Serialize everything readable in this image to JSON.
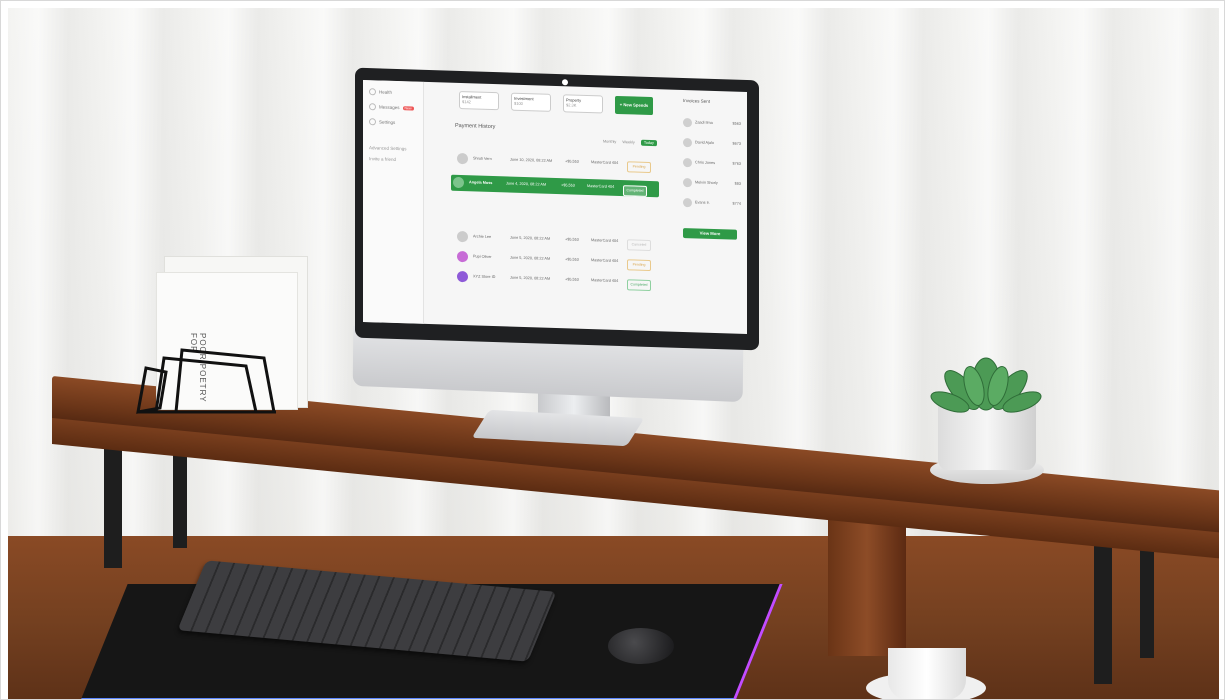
{
  "screen": {
    "sidebar": [
      {
        "label": "Health",
        "badge": ""
      },
      {
        "label": "Messages",
        "badge": "New"
      },
      {
        "label": "Settings",
        "badge": ""
      }
    ],
    "sidebar_footer": [
      "Advanced Settings",
      "Invite a friend"
    ],
    "cards": [
      {
        "label": "Installment",
        "value": "$142"
      },
      {
        "label": "Investment",
        "value": "$100"
      },
      {
        "label": "Property",
        "value": "$2.3K"
      }
    ],
    "new_spends_button": "+ New Spends",
    "payment_history_title": "Payment History",
    "filters": [
      "Monthly",
      "Weekly",
      "Today"
    ],
    "rows": [
      {
        "name": "Shruti Vern",
        "date": "June 10, 2020, 08:22 AM",
        "amount": "+$5,553",
        "method": "MasterCard 404",
        "status": "Pending"
      },
      {
        "name": "Angela Moss",
        "date": "June 4, 2020, 08:22 AM",
        "amount": "+$5,553",
        "method": "MasterCard 404",
        "status": "Completed"
      },
      {
        "name": "Archie Lee",
        "date": "June 5, 2020, 08:22 AM",
        "amount": "+$5,553",
        "method": "MasterCard 404",
        "status": "Canceled"
      },
      {
        "name": "Pupi Oliver",
        "date": "June 5, 2020, 08:22 AM",
        "amount": "+$5,553",
        "method": "MasterCard 404",
        "status": "Pending"
      },
      {
        "name": "XYZ Store ID",
        "date": "June 5, 2020, 08:22 AM",
        "amount": "+$5,553",
        "method": "MasterCard 404",
        "status": "Completed"
      }
    ],
    "invoices_title": "Invoices Sent",
    "invoices": [
      {
        "name": "Zaadi Ilma",
        "amount": "$563"
      },
      {
        "name": "David Ajalo",
        "amount": "$673"
      },
      {
        "name": "Chris Jones",
        "amount": "$763"
      },
      {
        "name": "Melvin Shorly",
        "amount": "$83"
      },
      {
        "name": "Evans Ir.",
        "amount": "$774"
      }
    ],
    "view_more_button": "View More"
  },
  "book_spine": "POOR POETRY FOR"
}
